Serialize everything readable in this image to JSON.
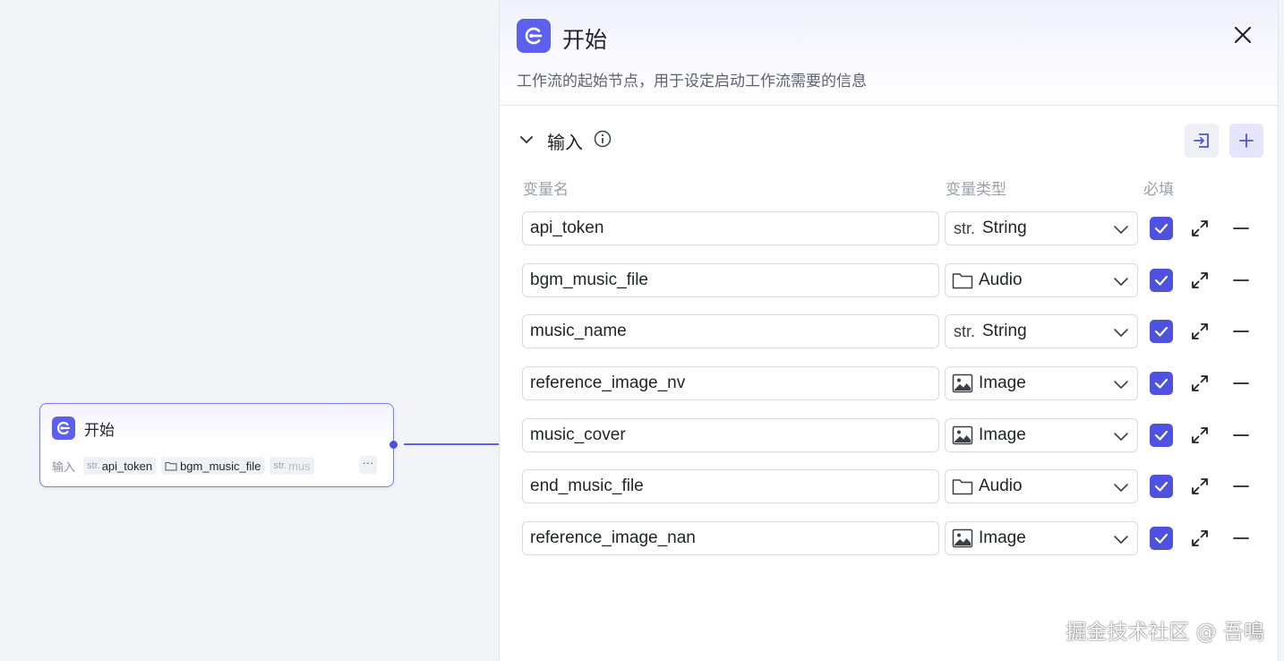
{
  "node": {
    "title": "开始",
    "inputs_label": "输入",
    "chips": [
      {
        "type": "str.",
        "name": "api_token"
      },
      {
        "type": "",
        "name": "bgm_music_file"
      },
      {
        "type": "str.",
        "name": "mus"
      }
    ],
    "more": "···"
  },
  "panel": {
    "title": "开始",
    "description": "工作流的起始节点，用于设定启动工作流需要的信息",
    "section_title": "输入",
    "columns": {
      "name": "变量名",
      "type": "变量类型",
      "required": "必填"
    },
    "variables": [
      {
        "name": "api_token",
        "type": "String",
        "type_icon": "str.",
        "icon": "string-icon",
        "required": true
      },
      {
        "name": "bgm_music_file",
        "type": "Audio",
        "type_icon": "",
        "icon": "folder-icon",
        "required": true
      },
      {
        "name": "music_name",
        "type": "String",
        "type_icon": "str.",
        "icon": "string-icon",
        "required": true
      },
      {
        "name": "reference_image_nv",
        "type": "Image",
        "type_icon": "",
        "icon": "image-icon",
        "required": true
      },
      {
        "name": "music_cover",
        "type": "Image",
        "type_icon": "",
        "icon": "image-icon",
        "required": true
      },
      {
        "name": "end_music_file",
        "type": "Audio",
        "type_icon": "",
        "icon": "folder-icon",
        "required": true
      },
      {
        "name": "reference_image_nan",
        "type": "Image",
        "type_icon": "",
        "icon": "image-icon",
        "required": true
      }
    ]
  },
  "colors": {
    "accent": "#5d5fef",
    "checkbox": "#4f51e0"
  },
  "watermark": "掘金技术社区 @ 吾鳴"
}
